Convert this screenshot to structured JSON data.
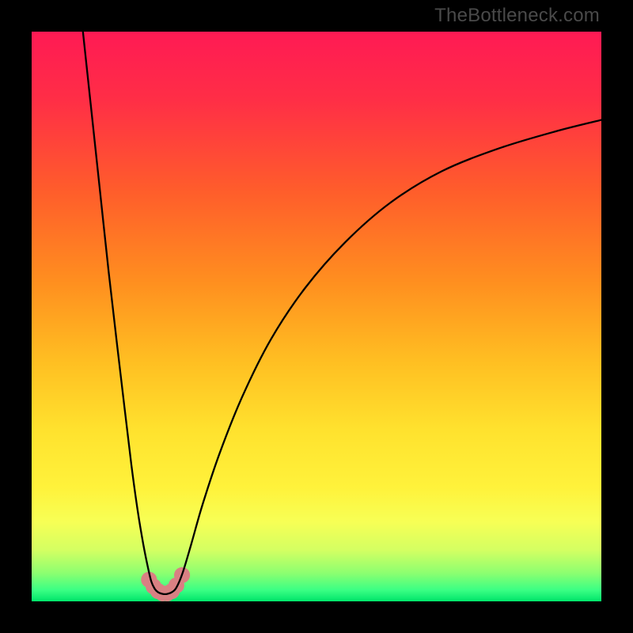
{
  "watermark": "TheBottleneck.com",
  "gradient_stops": [
    {
      "offset": 0.0,
      "color": "#ff1a54"
    },
    {
      "offset": 0.12,
      "color": "#ff2e46"
    },
    {
      "offset": 0.28,
      "color": "#ff5d2b"
    },
    {
      "offset": 0.44,
      "color": "#ff8f1f"
    },
    {
      "offset": 0.58,
      "color": "#ffbf22"
    },
    {
      "offset": 0.7,
      "color": "#ffe22e"
    },
    {
      "offset": 0.8,
      "color": "#fff23b"
    },
    {
      "offset": 0.86,
      "color": "#f7ff55"
    },
    {
      "offset": 0.91,
      "color": "#d4ff62"
    },
    {
      "offset": 0.95,
      "color": "#8dff70"
    },
    {
      "offset": 0.98,
      "color": "#3bff84"
    },
    {
      "offset": 1.0,
      "color": "#00e56a"
    }
  ],
  "colors": {
    "curve_stroke": "#000000",
    "marker_fill": "#d98083",
    "background": "#000000"
  },
  "chart_data": {
    "type": "line",
    "title": "",
    "xlabel": "",
    "ylabel": "",
    "xlim": [
      0,
      100
    ],
    "ylim": [
      0,
      100
    ],
    "series": [
      {
        "name": "left-branch",
        "x": [
          9.0,
          10.5,
          12.0,
          13.5,
          15.0,
          16.3,
          17.5,
          18.6,
          19.6,
          20.4,
          21.0,
          21.6
        ],
        "y": [
          100.0,
          86.0,
          72.0,
          58.0,
          45.0,
          34.0,
          24.0,
          16.0,
          10.0,
          6.0,
          3.5,
          2.2
        ]
      },
      {
        "name": "valley",
        "x": [
          21.6,
          22.2,
          23.0,
          23.8,
          24.6,
          25.4
        ],
        "y": [
          2.2,
          1.6,
          1.3,
          1.3,
          1.6,
          2.4
        ]
      },
      {
        "name": "right-branch",
        "x": [
          25.4,
          26.5,
          28.0,
          30.0,
          33.0,
          37.0,
          42.0,
          48.0,
          55.0,
          63.0,
          72.0,
          82.0,
          92.0,
          100.0
        ],
        "y": [
          2.4,
          5.0,
          10.0,
          17.0,
          26.0,
          36.0,
          46.0,
          55.0,
          63.0,
          70.0,
          75.5,
          79.5,
          82.5,
          84.5
        ]
      }
    ],
    "markers": {
      "name": "valley-markers",
      "x": [
        20.6,
        21.4,
        22.2,
        23.0,
        23.8,
        24.6,
        25.4,
        26.4
      ],
      "y": [
        3.8,
        2.6,
        1.8,
        1.4,
        1.4,
        1.8,
        2.8,
        4.6
      ],
      "r": 1.4
    }
  }
}
